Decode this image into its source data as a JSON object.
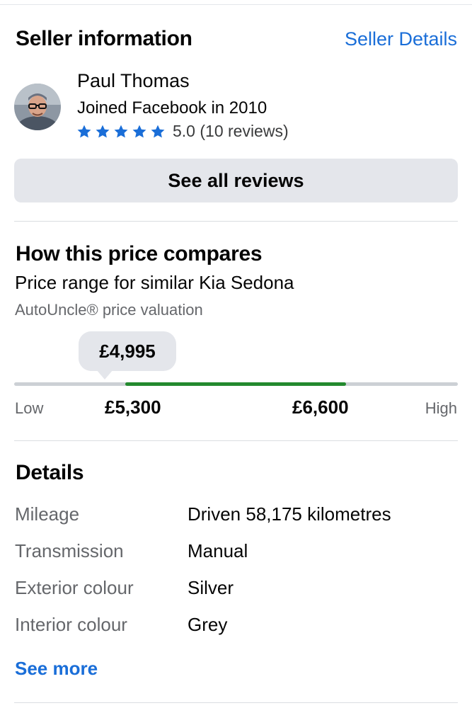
{
  "seller": {
    "title": "Seller information",
    "details_link": "Seller Details",
    "name": "Paul Thomas",
    "joined": "Joined Facebook in 2010",
    "rating": 5.0,
    "rating_text": "5.0 (10 reviews)",
    "stars": 5,
    "reviews_button": "See all reviews"
  },
  "price": {
    "title": "How this price compares",
    "subtitle": "Price range for similar Kia Sedona",
    "source": "AutoUncle® price valuation",
    "listing_price": "£4,995",
    "low_label": "Low",
    "high_label": "High",
    "range_low": "£5,300",
    "range_high": "£6,600",
    "colors": {
      "range_fill": "#23892e",
      "track": "#ccd0d5"
    }
  },
  "details": {
    "title": "Details",
    "rows": [
      {
        "label": "Mileage",
        "value": "Driven 58,175 kilometres"
      },
      {
        "label": "Transmission",
        "value": "Manual"
      },
      {
        "label": "Exterior colour",
        "value": "Silver"
      },
      {
        "label": "Interior colour",
        "value": "Grey"
      }
    ],
    "see_more": "See more"
  },
  "colors": {
    "link": "#1a6ed8",
    "star": "#1a6ed8"
  }
}
